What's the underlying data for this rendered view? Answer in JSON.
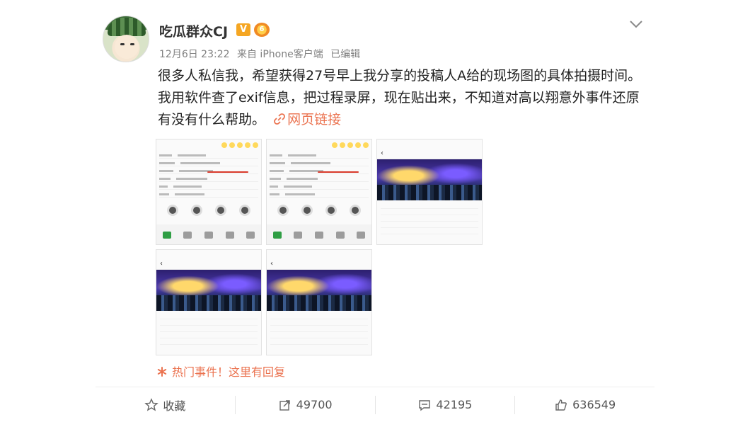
{
  "post": {
    "author": "吃瓜群众CJ",
    "verified_badge": "V",
    "level_badge": "6",
    "timestamp": "12月6日 23:22",
    "source": "来自 iPhone客户端",
    "edited": "已编辑",
    "text": "很多人私信我，希望获得27号早上我分享的投稿人A给的现场图的具体拍摄时间。我用软件查了exif信息，把过程录屏，现在贴出来，不知道对高以翔意外事件还原有没有什么帮助。",
    "link_label": "网页链接",
    "hot_topic": "热门事件！这里有回复"
  },
  "actions": {
    "favorite": "收藏",
    "repost_count": "49700",
    "comment_count": "42195",
    "like_count": "636549"
  },
  "colors": {
    "accent": "#eb7350",
    "verified": "#f5a623",
    "underline": "#d93a2b"
  }
}
